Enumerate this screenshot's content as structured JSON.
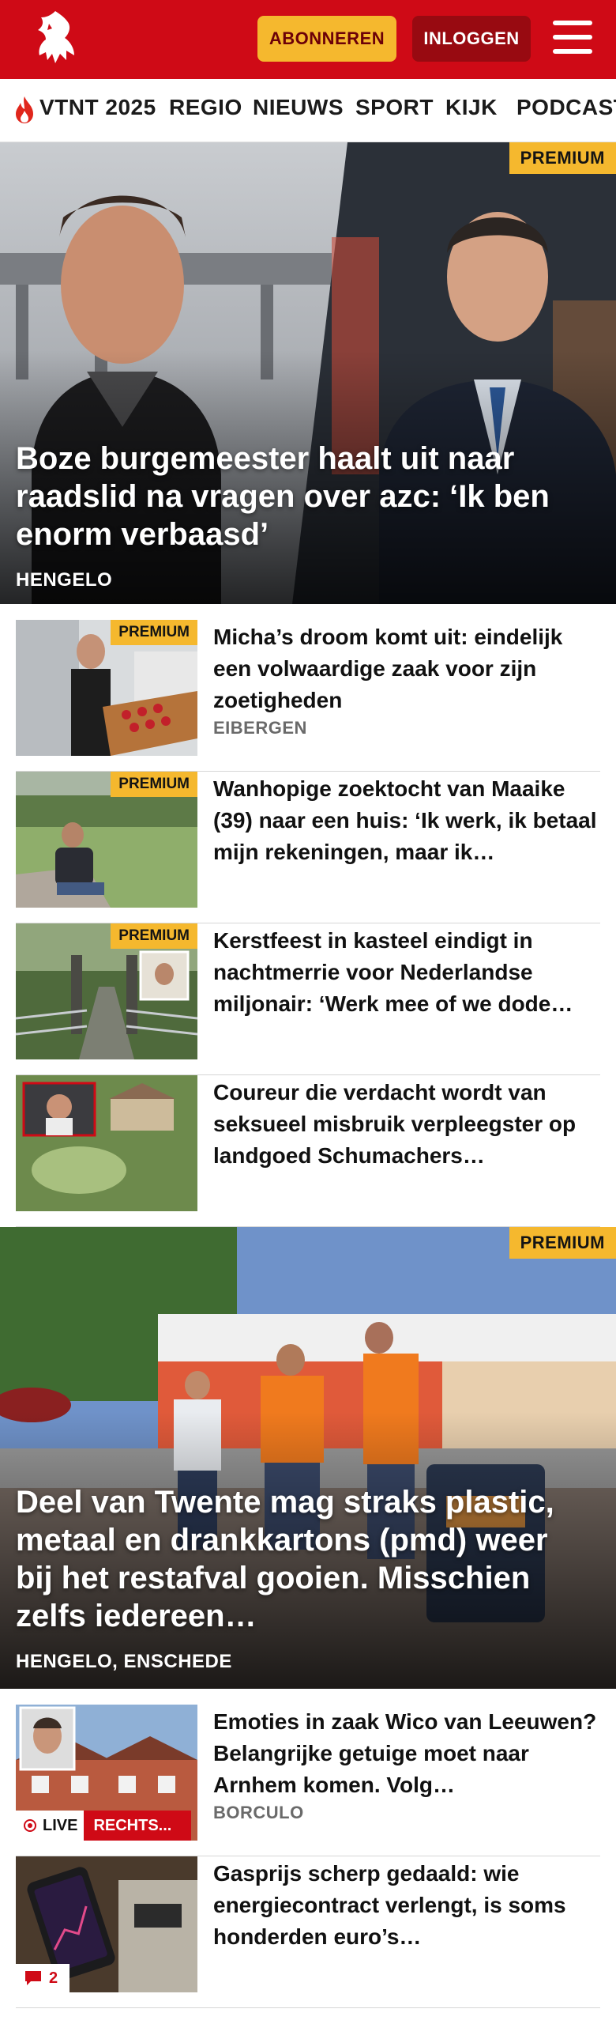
{
  "header": {
    "subscribe_label": "ABONNEREN",
    "login_label": "INLOGGEN",
    "brand_color": "#cf0a16",
    "accent_color": "#f5b82e"
  },
  "nav": {
    "items": [
      "VTNT 2025",
      "REGIO",
      "NIEUWS",
      "SPORT",
      "KIJK",
      "PODCAST"
    ]
  },
  "hero1": {
    "badge": "PREMIUM",
    "title": "Boze burgemeester haalt uit naar raadslid na vragen over azc: ‘Ik ben enorm verbaasd’",
    "place": "HENGELO"
  },
  "articles": [
    {
      "badge": "PREMIUM",
      "headline": "Micha’s droom komt uit: eindelijk een volwaardige zaak voor zijn zoetigheden",
      "location": "EIBERGEN"
    },
    {
      "badge": "PREMIUM",
      "headline": "Wanhopige zoektocht van Maaike (39) naar een huis: ‘Ik werk, ik betaal mijn rekeningen, maar ik…"
    },
    {
      "badge": "PREMIUM",
      "headline": "Kerstfeest in kasteel eindigt in nachtmerrie voor Nederlandse miljonair: ‘Werk mee of we dode…"
    },
    {
      "headline": "Coureur die verdacht wordt van seksueel misbruik verpleegster op landgoed Schumachers…"
    }
  ],
  "hero2": {
    "badge": "PREMIUM",
    "title": "Deel van Twente mag straks plastic, metaal en drankkartons (pmd) weer bij het restafval gooien. Misschien zelfs iedereen…",
    "place": "HENGELO, ENSCHEDE"
  },
  "articles2": [
    {
      "headline": "Emoties in zaak Wico van Leeuwen? Belangrijke getuige moet naar Arnhem komen. Volg…",
      "location": "BORCULO",
      "live_label": "LIVE",
      "tag": "RECHTS..."
    },
    {
      "headline": "Gasprijs scherp gedaald: wie energiecontract verlengt, is soms honderden euro’s…",
      "comment_count": "2"
    }
  ]
}
